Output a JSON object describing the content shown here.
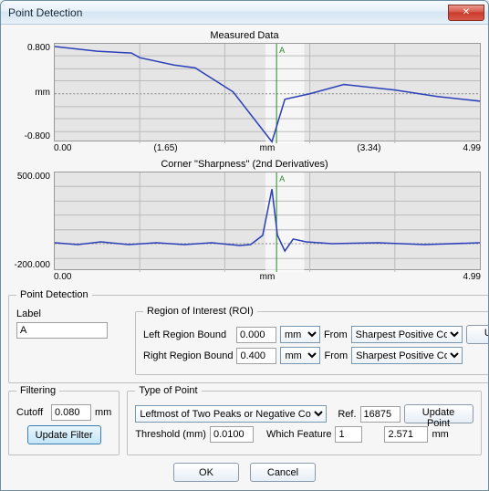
{
  "window": {
    "title": "Point Detection",
    "close_glyph": "✕"
  },
  "charts": {
    "top": {
      "title": "Measured Data",
      "ylabel": "mm",
      "yhi": "0.800",
      "ylo": "-0.800",
      "x": {
        "t0": "0.00",
        "t1": "(1.65)",
        "t2": "mm",
        "t3": "(3.34)",
        "t4": "4.99"
      },
      "marker_label": "A"
    },
    "bot": {
      "title": "Corner \"Sharpness\" (2nd Derivatives)",
      "yhi": "500.000",
      "ylo": "-200.000",
      "x": {
        "t0": "0.00",
        "t2": "mm",
        "t4": "4.99"
      },
      "marker_label": "A"
    }
  },
  "point_detection": {
    "legend": "Point Detection",
    "label_label": "Label",
    "label_value": "A"
  },
  "roi": {
    "legend": "Region of Interest (ROI)",
    "left_label": "Left Region Bound",
    "left_value": "0.000",
    "right_label": "Right Region Bound",
    "right_value": "0.400",
    "unit_option": "mm",
    "from_label": "From",
    "anchor_option": "Sharpest Positive Co",
    "update": "Update ROI"
  },
  "filtering": {
    "legend": "Filtering",
    "cutoff_label": "Cutoff",
    "cutoff_value": "0.080",
    "cutoff_unit": "mm",
    "update": "Update Filter"
  },
  "type_of_point": {
    "legend": "Type of Point",
    "type_option": "Leftmost of Two Peaks or Negative Corners",
    "ref_label": "Ref.",
    "ref_value": "16875",
    "update": "Update Point",
    "thresh_label": "Threshold (mm)",
    "thresh_value": "0.0100",
    "which_label": "Which Feature",
    "which_value": "1",
    "result_value": "2.571",
    "result_unit": "mm"
  },
  "buttons": {
    "ok": "OK",
    "cancel": "Cancel"
  },
  "chart_data": [
    {
      "type": "line",
      "title": "Measured Data",
      "xlabel": "mm",
      "ylabel": "mm",
      "xlim": [
        0.0,
        4.99
      ],
      "ylim": [
        -0.8,
        0.8
      ],
      "annotations": [
        {
          "label": "A",
          "x": 2.6
        }
      ],
      "series": [
        {
          "name": "profile",
          "x": [
            0.0,
            0.5,
            0.9,
            1.0,
            1.4,
            1.65,
            2.1,
            2.55,
            2.7,
            3.0,
            3.4,
            4.0,
            4.5,
            4.99
          ],
          "y": [
            0.82,
            0.75,
            0.7,
            0.65,
            0.55,
            0.5,
            0.05,
            -0.8,
            -0.1,
            0.0,
            0.15,
            0.05,
            -0.05,
            -0.15
          ]
        }
      ]
    },
    {
      "type": "line",
      "title": "Corner \"Sharpness\" (2nd Derivatives)",
      "xlabel": "mm",
      "ylabel": "",
      "xlim": [
        0.0,
        4.99
      ],
      "ylim": [
        -200,
        500
      ],
      "annotations": [
        {
          "label": "A",
          "x": 2.6
        }
      ],
      "series": [
        {
          "name": "sharpness",
          "x": [
            0.0,
            2.3,
            2.45,
            2.55,
            2.62,
            2.7,
            2.8,
            2.95,
            4.99
          ],
          "y": [
            5,
            -5,
            60,
            380,
            60,
            -40,
            30,
            10,
            5
          ]
        }
      ]
    }
  ]
}
